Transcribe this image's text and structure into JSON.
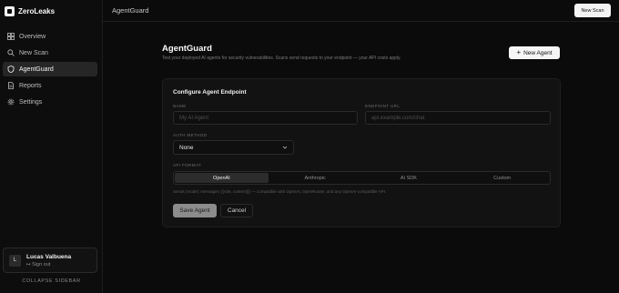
{
  "brand": {
    "name": "ZeroLeaks"
  },
  "sidebar": {
    "items": [
      {
        "label": "Overview",
        "icon": "grid-icon",
        "active": false
      },
      {
        "label": "New Scan",
        "icon": "search-icon",
        "active": false
      },
      {
        "label": "AgentGuard",
        "icon": "shield-icon",
        "active": true
      },
      {
        "label": "Reports",
        "icon": "document-icon",
        "active": false
      },
      {
        "label": "Settings",
        "icon": "gear-icon",
        "active": false
      }
    ],
    "user": {
      "initial": "L",
      "name": "Lucas Valbuena",
      "sign_out": "Sign out"
    },
    "collapse_label": "COLLAPSE SIDEBAR"
  },
  "topbar": {
    "title": "AgentGuard",
    "new_scan_label": "New Scan"
  },
  "main": {
    "title": "AgentGuard",
    "subtitle": "Test your deployed AI agents for security vulnerabilities. Scans send requests to your endpoint — your API costs apply.",
    "new_agent_label": "New Agent"
  },
  "form": {
    "title": "Configure Agent Endpoint",
    "name_label": "NAME",
    "name_placeholder": "My AI Agent",
    "endpoint_label": "ENDPOINT URL",
    "endpoint_placeholder": "api.example.com/chat",
    "auth_label": "AUTH METHOD",
    "auth_value": "None",
    "format_label": "API FORMAT",
    "formats": [
      "OpenAI",
      "Anthropic",
      "AI SDK",
      "Custom"
    ],
    "active_format": "OpenAI",
    "format_hint": "Sends {model, messages: [{role, content}]} — compatible with OpenAI, OpenRouter, and any OpenAI-compatible API.",
    "save_label": "Save Agent",
    "cancel_label": "Cancel"
  },
  "colors": {
    "background": "#0b0b0b",
    "card": "#121212",
    "active_nav": "#262626",
    "primary_button": "#f5f5f5"
  }
}
